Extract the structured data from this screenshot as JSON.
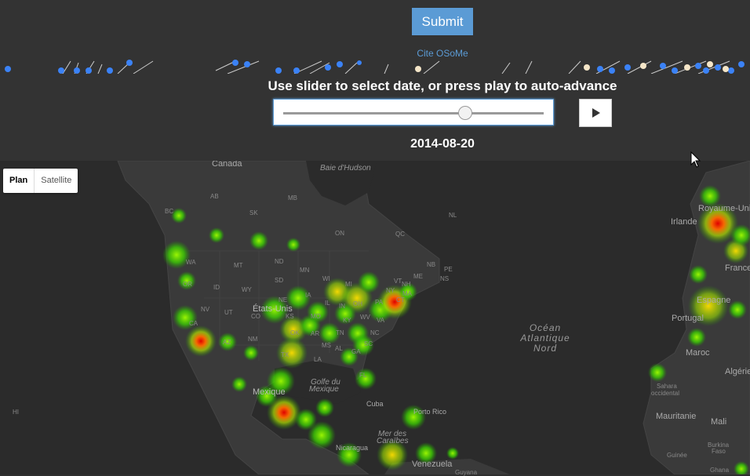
{
  "controls": {
    "submit_label": "Submit",
    "cite_label": "Cite OSoMe",
    "instruction": "Use slider to select date, or press play to auto-advance",
    "date_value": "2014-08-20",
    "slider_position_fraction": 0.7,
    "accent_color": "#5b9bd5"
  },
  "map_type": {
    "plan": "Plan",
    "satellite": "Satellite",
    "selected": "Plan"
  },
  "labels": {
    "canada": "Canada",
    "baie": "Baie d'Hudson",
    "etats_unis": "États-Unis",
    "mexique": "Mexique",
    "golfe_l1": "Golfe du",
    "golfe_l2": "Mexique",
    "cuba": "Cuba",
    "porto_rico": "Porto Rico",
    "mer_l1": "Mer des",
    "mer_l2": "Caraïbes",
    "nicaragua": "Nicaragua",
    "venezuela": "Venezuela",
    "guyana": "Guyana",
    "ocean_l1": "Océan",
    "ocean_l2": "Atlantique",
    "ocean_l3": "Nord",
    "irlande": "Irlande",
    "royaume_uni": "Royaume-Uni",
    "france": "France",
    "espagne": "Espagne",
    "portugal": "Portugal",
    "maroc": "Maroc",
    "algerie": "Algérie",
    "sahara_l1": "Sahara",
    "sahara_l2": "occidental",
    "mauritanie": "Mauritanie",
    "mali": "Mali",
    "burkina_l1": "Burkina",
    "burkina_l2": "Faso",
    "guinee": "Guinée",
    "ghana": "Ghana",
    "hi": "HI",
    "bc": "BC",
    "ab": "AB",
    "sk": "SK",
    "mb": "MB",
    "on": "ON",
    "qc": "QC",
    "nl": "NL",
    "nb": "NB",
    "pe": "PE",
    "ns": "NS",
    "wa": "WA",
    "or": "OR",
    "ca": "CA",
    "nv": "NV",
    "id": "ID",
    "mt": "MT",
    "wy": "WY",
    "ut": "UT",
    "az": "AZ",
    "co": "CO",
    "nm": "NM",
    "nd": "ND",
    "sd": "SD",
    "ne": "NE",
    "ks": "KS",
    "ok": "OK",
    "tx": "TX",
    "mn": "MN",
    "ia": "IA",
    "mo": "MO",
    "ar": "AR",
    "la": "LA",
    "wi": "WI",
    "il": "IL",
    "mi": "MI",
    "in": "IN",
    "oh": "OH",
    "ky": "KY",
    "tn": "TN",
    "ms": "MS",
    "al": "AL",
    "ga": "GA",
    "fl": "FL",
    "sc": "SC",
    "nc": "NC",
    "va": "VA",
    "wv": "WV",
    "pa": "PA",
    "ny": "NY",
    "me": "ME",
    "vt": "VT",
    "nh": "NH",
    "ma": "MA",
    "ct": "CT"
  }
}
